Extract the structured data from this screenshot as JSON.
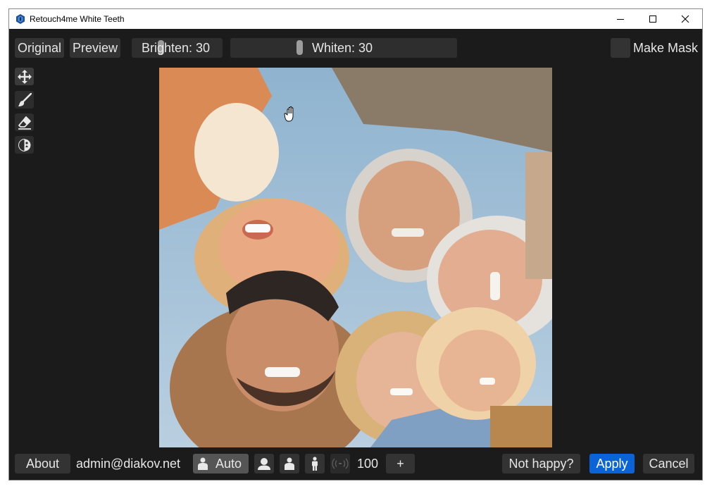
{
  "window": {
    "title": "Retouch4me White Teeth"
  },
  "toolbar": {
    "original_label": "Original",
    "preview_label": "Preview",
    "brighten": {
      "label": "Brighten: 30",
      "value": 30
    },
    "whiten": {
      "label": "Whiten: 30",
      "value": 30
    },
    "make_mask_label": "Make Mask"
  },
  "tools": [
    "move-icon",
    "brush-icon",
    "eraser-icon",
    "compare-icon"
  ],
  "footer": {
    "about_label": "About",
    "user_email": "admin@diakov.net",
    "auto_label": "Auto",
    "zoom_value": "100",
    "minus_label": "-",
    "plus_label": "+",
    "not_happy_label": "Not happy?",
    "apply_label": "Apply",
    "cancel_label": "Cancel"
  },
  "colors": {
    "accent": "#0a64d8",
    "panel": "#1b1b1b",
    "button": "#333333"
  }
}
